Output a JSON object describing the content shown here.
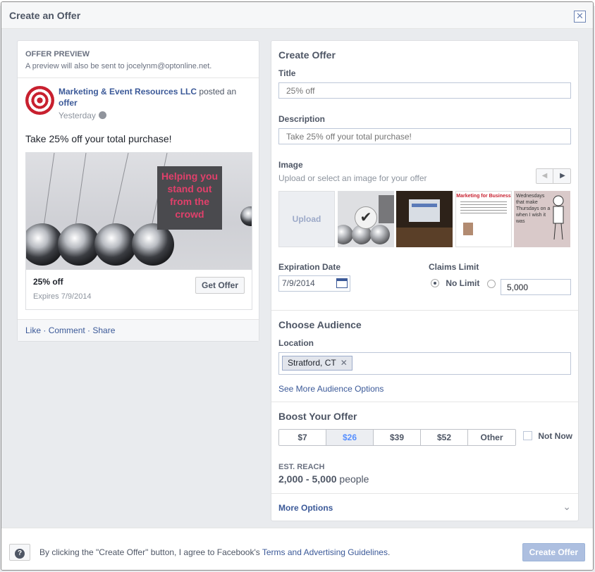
{
  "dialog": {
    "title": "Create an Offer"
  },
  "preview": {
    "label": "OFFER PREVIEW",
    "note": "A preview will also be sent to jocelynm@optonline.net.",
    "page_name": "Marketing & Event Resources LLC",
    "posted": "posted an",
    "offer_link": "offer",
    "time": "Yesterday",
    "post_text": "Take 25% off your total purchase!",
    "image_text": "Helping you stand out from the crowd",
    "offer_title": "25% off",
    "expires": "Expires 7/9/2014",
    "get_offer": "Get Offer",
    "actions": {
      "like": "Like",
      "comment": "Comment",
      "share": "Share",
      "sep": " · "
    }
  },
  "form": {
    "heading": "Create Offer",
    "title_label": "Title",
    "title_placeholder": "25% off",
    "description_label": "Description",
    "description_placeholder": "Take 25% off your total purchase!",
    "image_label": "Image",
    "image_sub": "Upload or select an image for your offer",
    "upload_label": "Upload Image",
    "thumb2_text": "Marketing for Business",
    "thumb3_text": "Wednesdays that make Thursdays on a when I wish it was",
    "expiration_label": "Expiration Date",
    "expiration_value": "7/9/2014",
    "claims_label": "Claims Limit",
    "no_limit": "No Limit",
    "claims_value": "5,000"
  },
  "audience": {
    "heading": "Choose Audience",
    "location_label": "Location",
    "location_token": "Stratford, CT",
    "more_link": "See More Audience Options"
  },
  "boost": {
    "heading": "Boost Your Offer",
    "options": [
      "$7",
      "$26",
      "$39",
      "$52",
      "Other"
    ],
    "selected_index": 1,
    "not_now": "Not Now",
    "reach_label": "EST. REACH",
    "reach_value": "2,000 - 5,000",
    "reach_unit": "people"
  },
  "more_options": "More Options",
  "footer": {
    "help": "?",
    "terms_prefix": "By clicking the \"Create Offer\" button, I agree to Facebook's",
    "terms_link": "Terms and Advertising Guidelines",
    "terms_suffix": ".",
    "create_button": "Create Offer"
  }
}
